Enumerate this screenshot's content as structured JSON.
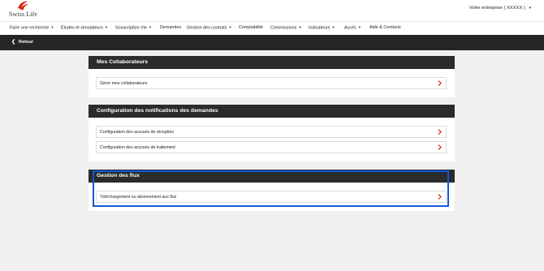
{
  "brand": {
    "name": "Swiss Life",
    "accent": "#d81e05"
  },
  "header": {
    "company_label": "Votre entreprise",
    "company_value": "( XXXXX )",
    "company_icon": "chevron-down-icon"
  },
  "nav": {
    "items": [
      {
        "label": "Faire une recherche",
        "caret": "▾"
      },
      {
        "label": "Études et simulateurs",
        "caret": "▾"
      },
      {
        "label": "Souscription Vie",
        "caret": "▾"
      },
      {
        "label": "Demandes",
        "caret": ""
      },
      {
        "label": "Gestion des contrats",
        "caret": "▾"
      },
      {
        "label": "Comptabilité",
        "caret": ""
      },
      {
        "label": "Commissions",
        "caret": "▾"
      },
      {
        "label": "Indicateurs",
        "caret": "▾"
      },
      {
        "label": "Accès",
        "caret": "▾"
      },
      {
        "label": "Aide & Contacts",
        "caret": ""
      }
    ]
  },
  "back": {
    "label": "Retour",
    "icon": "chevron-left-icon"
  },
  "panels": [
    {
      "title": "Mes Collaborateurs",
      "rows": [
        {
          "label": "Gérer mes collaborateurs"
        }
      ]
    },
    {
      "title": "Configuration des notifications des demandes",
      "rows": [
        {
          "label": "Configuration des accusés de réception"
        },
        {
          "label": "Configuration des accusés de traitement"
        }
      ]
    },
    {
      "title": "Gestion des flux",
      "rows": [
        {
          "label": "Téléchargement ou abonnement aux flux"
        }
      ]
    }
  ],
  "colors": {
    "chevron": "#d81e05",
    "dark_bar": "#262626",
    "panel_header": "#2b2b2b",
    "highlight": "#1458d6",
    "background": "#f0f0f0"
  }
}
